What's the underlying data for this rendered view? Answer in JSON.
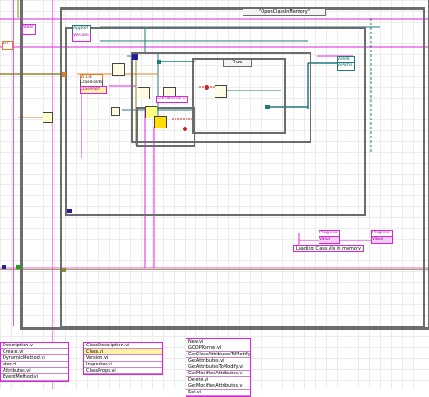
{
  "case_structure": {
    "selector": "\"OpenClassInMemory\""
  },
  "inner_case": {
    "selector": "True"
  },
  "labels": {
    "state": "State",
    "error": "Err",
    "appref": "AppRef",
    "version": "Version",
    "vilib": "VI.LIB",
    "classfolder": "ClassFolder",
    "classpath": "ClassPath",
    "goopkernel": "GOOPKernel.vi",
    "viref": "ViRefs",
    "vipaths": "ViPaths",
    "progress1": "Progress",
    "progress2": "Progress",
    "propname": "Value",
    "propname2": "Value",
    "loading": "Loading Class Vis in memory"
  },
  "lists": {
    "left": [
      "Description.vi",
      "Create.vi",
      "DynamicMethod.vi",
      "ctor.vi",
      "Attributes.vi",
      "EventMethod.vi"
    ],
    "middle": [
      "ClassDescription.vi",
      "Class.vi",
      "Version.vi",
      "Inspector.vi",
      "ClassProps.vi"
    ],
    "right": [
      "New.vi",
      "GOOPKernel.vi",
      "GetClassAttributesToModify.vi",
      "GetAttributes.vi",
      "GetAttributesToModify.vi",
      "GetModifiedAttributes.vi",
      "Delete.vi",
      "GetModifiedAttributes.vi",
      "Set.vi"
    ]
  },
  "colors": {
    "pink": "#e020e0",
    "teal": "#1f7a7a",
    "orange": "#e08020",
    "olive": "#8a8a20",
    "frame": "#6c6c6c"
  }
}
